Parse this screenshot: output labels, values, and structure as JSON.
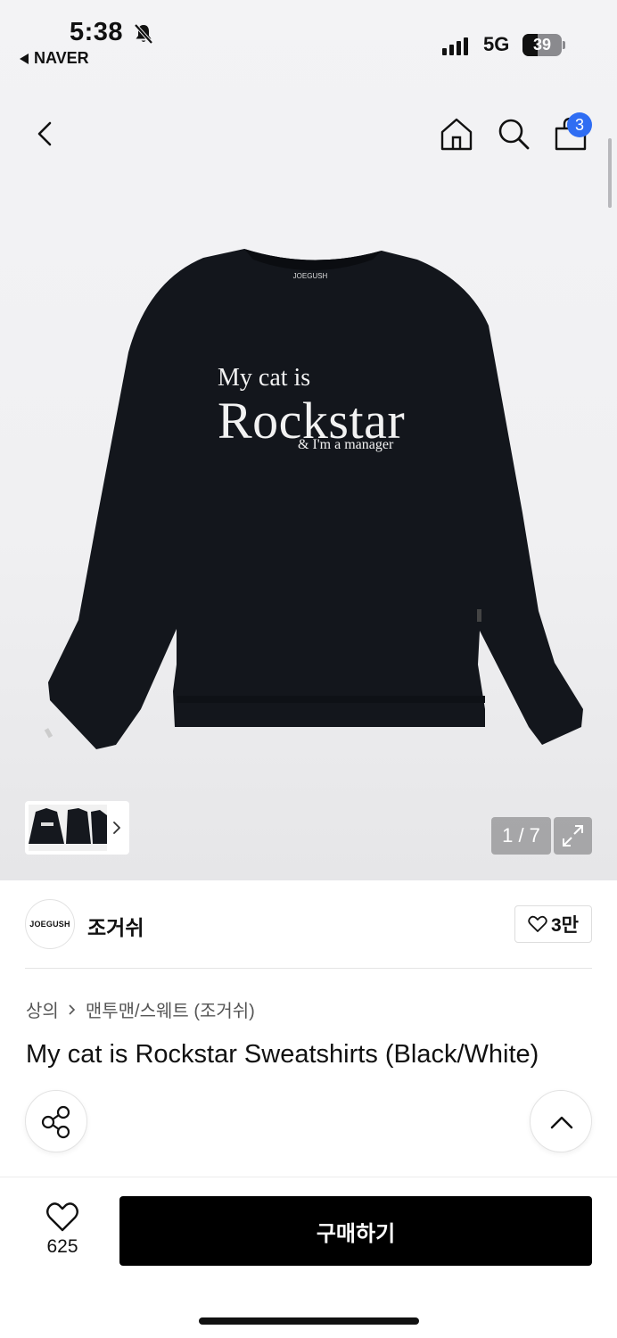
{
  "status_bar": {
    "time": "5:38",
    "back_app": "NAVER",
    "network": "5G",
    "battery": "39"
  },
  "nav": {
    "back_icon": "chevron-left-icon",
    "home_icon": "home-icon",
    "search_icon": "search-icon",
    "cart_icon": "shopping-bag-icon",
    "cart_count": "3"
  },
  "gallery": {
    "shirt_print": {
      "line1": "My cat is",
      "line2": "Rockstar",
      "line3": "& I'm a manager"
    },
    "neck_label": "JOEGUSH",
    "counter": "1 / 7",
    "expand_icon": "expand-icon"
  },
  "brand": {
    "logo_text": "JOEGUSH",
    "name": "조거쉬",
    "likes": "3만"
  },
  "breadcrumb": {
    "level1": "상의",
    "level2": "맨투맨/스웨트 (조거쉬)"
  },
  "product": {
    "title": "My cat is Rockstar Sweatshirts (Black/White)"
  },
  "bottom": {
    "like_count": "625",
    "buy_label": "구매하기"
  },
  "colors": {
    "accent_badge": "#2f6df3",
    "buy_button": "#000000"
  }
}
